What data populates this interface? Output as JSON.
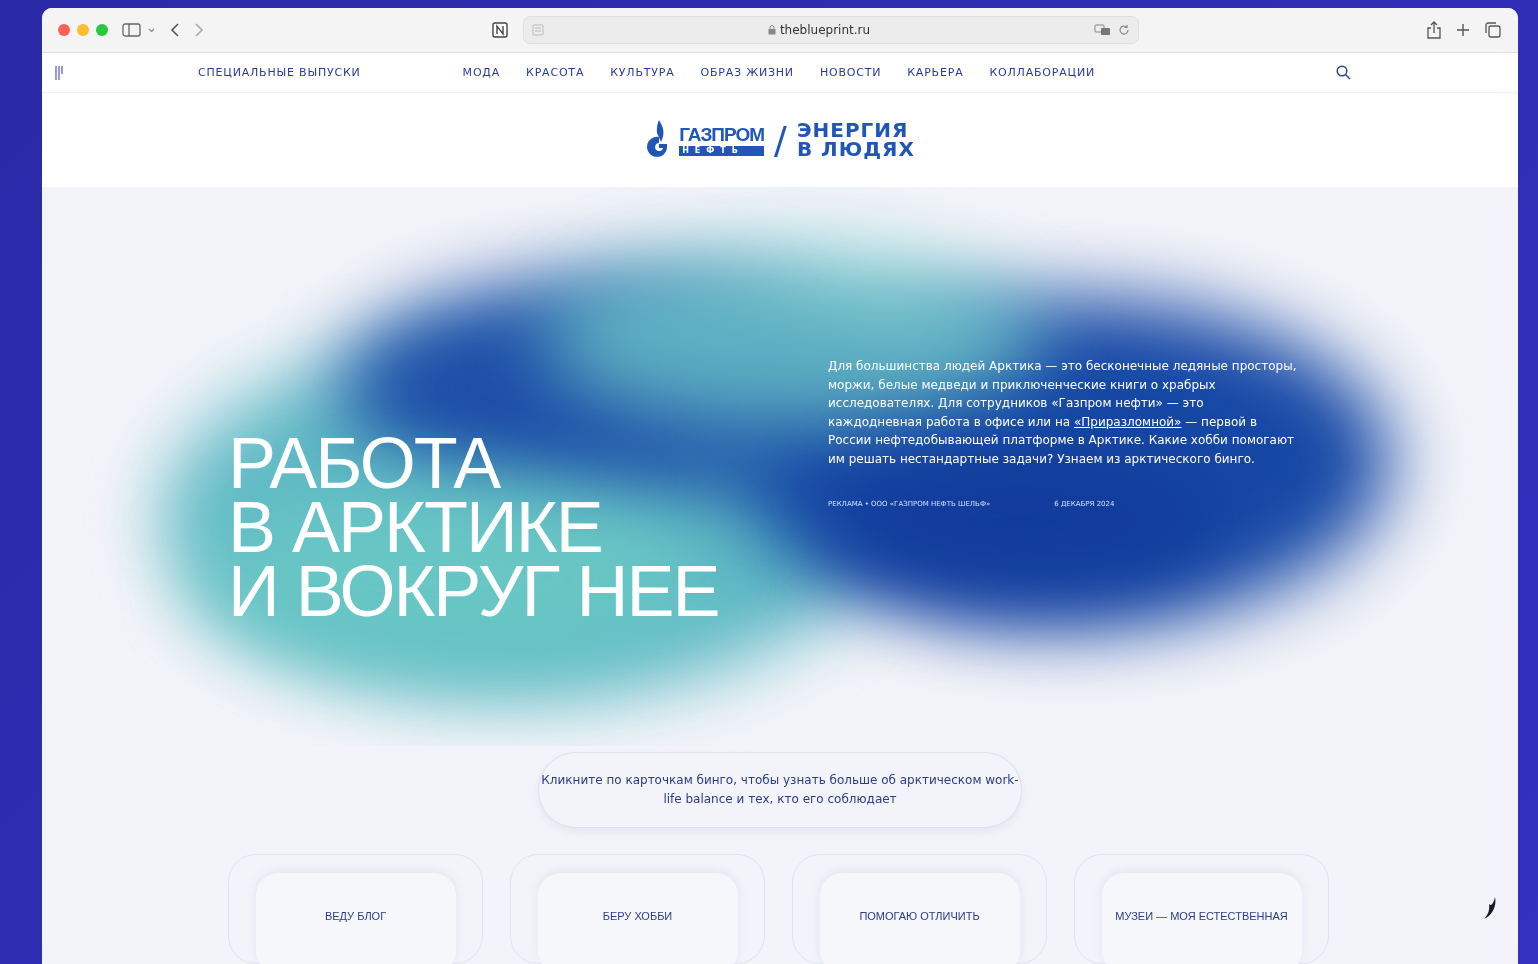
{
  "browser": {
    "url": "theblueprint.ru"
  },
  "nav": {
    "items": [
      {
        "label": "СПЕЦИАЛЬНЫЕ ВЫПУСКИ"
      },
      {
        "label": "МОДА"
      },
      {
        "label": "КРАСОТА"
      },
      {
        "label": "КУЛЬТУРА"
      },
      {
        "label": "ОБРАЗ ЖИЗНИ"
      },
      {
        "label": "НОВОСТИ"
      },
      {
        "label": "КАРЬЕРА"
      },
      {
        "label": "КОЛЛАБОРАЦИИ"
      }
    ]
  },
  "partner_logo": {
    "brand": "ГАЗПРОМ",
    "brand_sub": "НЕФТЬ",
    "slash": "/",
    "slogan_lines": [
      "ЭНЕРГИЯ",
      "В ЛЮДЯХ"
    ]
  },
  "hero": {
    "title_lines": [
      "РАБОТА",
      "В АРКТИКЕ",
      "И ВОКРУГ НЕЕ"
    ],
    "intro_before": "Для большинства людей Арктика — это бесконечные ледяные просторы, моржи, белые медведи и приключенческие книги о храбрых исследователях. Для сотрудников «Газпром нефти» — это каждодневная работа в офисе или на ",
    "intro_link": "«Приразломной»",
    "intro_after": " — первой в России нефтедобывающей платформе в Арктике. Какие хобби помогают им решать нестандартные задачи? Узнаем из арктического бинго.",
    "sponsor": "РЕКЛАМА • ООО «ГАЗПРОМ НЕФТЬ ШЕЛЬФ»",
    "date": "6 ДЕКАБРЯ 2024"
  },
  "hint": "Кликните по карточкам бинго, чтобы узнать больше об арктическом work-life balance и тех, кто его соблюдает",
  "bingo_cards": [
    {
      "label": "ВЕДУ БЛОГ"
    },
    {
      "label": "БЕРУ ХОББИ"
    },
    {
      "label": "ПОМОГАЮ ОТЛИЧИТЬ"
    },
    {
      "label": "МУЗЕИ — МОЯ ЕСТЕСТВЕННАЯ"
    }
  ]
}
